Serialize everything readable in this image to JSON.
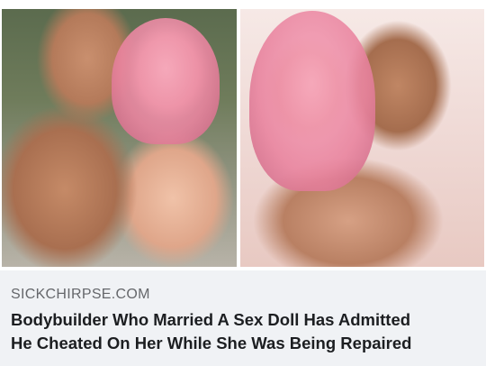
{
  "link_preview": {
    "source": "SICKCHIRPSE.COM",
    "headline_lines": [
      "Bodybuilder Who Married A Sex Doll Has Admitted",
      "He Cheated On Her While She Was Being Repaired"
    ]
  },
  "colors": {
    "background": "#f0f2f5",
    "source_text": "#65676b",
    "headline_text": "#1c1e21",
    "hair_pink": "#e9849f"
  }
}
